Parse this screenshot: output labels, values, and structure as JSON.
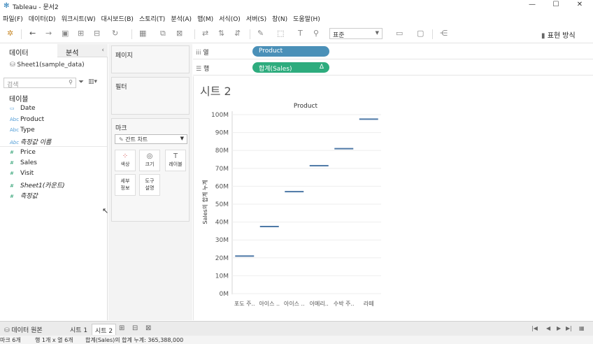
{
  "window": {
    "title": "Tableau - 문서2",
    "controls": [
      "minimize-icon",
      "maximize-icon",
      "close-icon"
    ]
  },
  "menu": [
    "파일(F)",
    "데이터(D)",
    "워크시트(W)",
    "대시보드(B)",
    "스토리(T)",
    "분석(A)",
    "맵(M)",
    "서식(O)",
    "서버(S)",
    "창(N)",
    "도움말(H)"
  ],
  "toolbar": {
    "fit_select": "표준",
    "show_me": "표현 방식"
  },
  "left": {
    "tab_data": "데이터",
    "tab_analysis": "분석",
    "datasource": "Sheet1(sample_data)",
    "search_placeholder": "검색",
    "tables_header": "테이블",
    "dimensions": [
      {
        "label": "Date",
        "icon": "calendar-icon"
      },
      {
        "label": "Product",
        "icon": "abc-icon"
      },
      {
        "label": "Type",
        "icon": "abc-icon"
      },
      {
        "label": "측정값 이름",
        "icon": "abc-icon"
      }
    ],
    "measures": [
      {
        "label": "Price",
        "icon": "hash-icon"
      },
      {
        "label": "Sales",
        "icon": "hash-icon"
      },
      {
        "label": "Visit",
        "icon": "hash-icon"
      },
      {
        "label": "Sheet1(카운트)",
        "icon": "hash-icon"
      },
      {
        "label": "측정값",
        "icon": "hash-icon"
      }
    ]
  },
  "cards": {
    "pages": "페이지",
    "filters": "필터",
    "marks": "마크",
    "mark_type": "간트 차트",
    "mark_buttons": [
      "색상",
      "크기",
      "레이블",
      "세부\n정보",
      "도구\n설명"
    ]
  },
  "shelves": {
    "columns_label": "열",
    "rows_label": "행",
    "columns_pill": "Product",
    "rows_pill": "합계(Sales)",
    "rows_pill_delta": "Δ",
    "columns_color": "#4a90b8",
    "rows_color": "#2eac7e"
  },
  "view": {
    "sheet_title": "시트 2"
  },
  "chart_data": {
    "type": "bar",
    "mark": "gantt",
    "title": "Product",
    "ylabel": "Sales의 합계 누계",
    "xlabel": "",
    "categories": [
      "포도 주..",
      "아이스 ..",
      "아이스 ..",
      "아메리..",
      "수박 주..",
      "라떼"
    ],
    "values": [
      21,
      37.5,
      57,
      71.5,
      81,
      97.5
    ],
    "unit": "M",
    "ylim": [
      0,
      100
    ],
    "yticks": [
      "0M",
      "10M",
      "20M",
      "30M",
      "40M",
      "50M",
      "60M",
      "70M",
      "80M",
      "90M",
      "100M"
    ],
    "color": "#4e79a7",
    "grid": true
  },
  "bottom": {
    "datasource_tab": "데이터 원본",
    "sheets": [
      "시트 1",
      "시트 2"
    ],
    "active_sheet": "시트 2"
  },
  "status": {
    "marks": "마크 6개",
    "rowcol": "행 1개 x 열 6개",
    "sum": "합계(Sales)의 합계 누계: 365,388,000"
  }
}
